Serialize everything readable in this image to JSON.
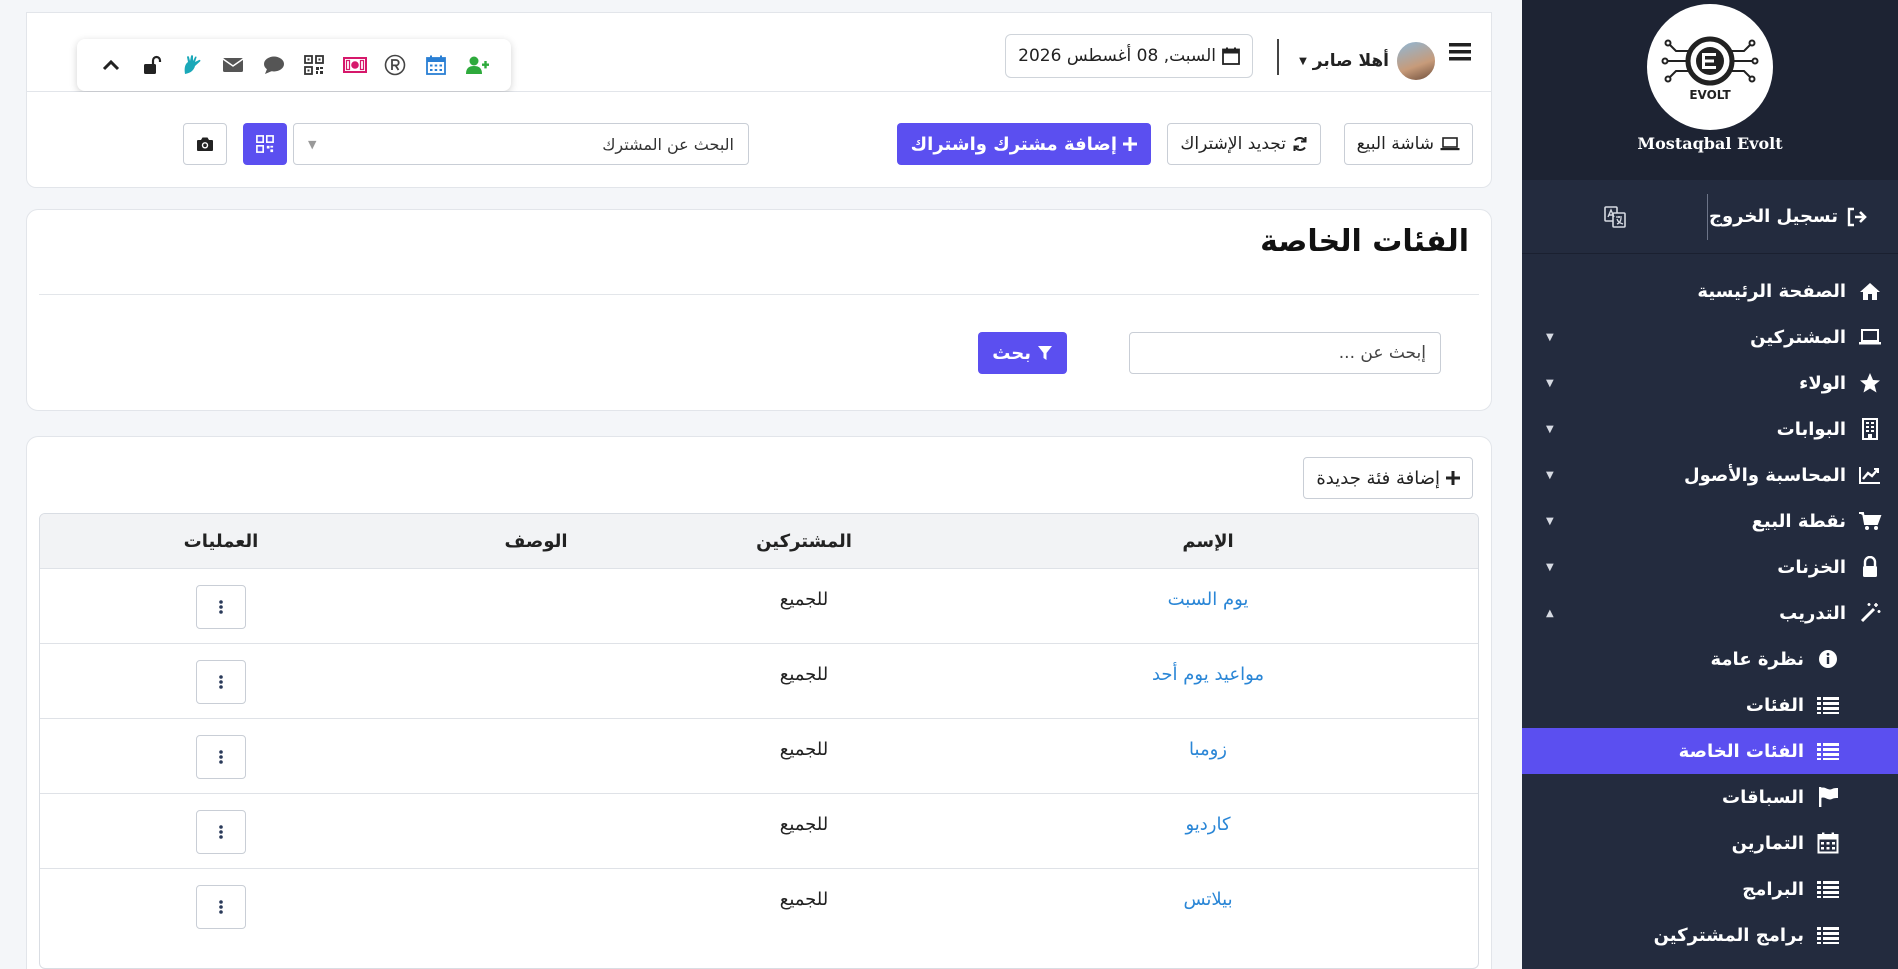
{
  "sidebar": {
    "brand": "Mostaqbal Evolt",
    "logo_text": "EVOLT",
    "logout_label": "تسجيل الخروج",
    "items": [
      {
        "label": "الصفحة الرئيسية",
        "icon": "home-icon",
        "caret": ""
      },
      {
        "label": "المشتركين",
        "icon": "laptop-icon",
        "caret": "▼"
      },
      {
        "label": "الولاء",
        "icon": "star-icon",
        "caret": "▼"
      },
      {
        "label": "البوابات",
        "icon": "building-icon",
        "caret": "▼"
      },
      {
        "label": "المحاسبة والأصول",
        "icon": "chart-line-icon",
        "caret": "▼"
      },
      {
        "label": "نقطة البيع",
        "icon": "cart-icon",
        "caret": "▼"
      },
      {
        "label": "الخزنات",
        "icon": "lock-icon",
        "caret": "▼"
      },
      {
        "label": "التدريب",
        "icon": "magic-wand-icon",
        "caret": "▲"
      }
    ],
    "subitems": [
      {
        "label": "نظرة عامة",
        "icon": "info-icon"
      },
      {
        "label": "الفئات",
        "icon": "list-icon"
      },
      {
        "label": "الفئات الخاصة",
        "icon": "list-icon",
        "active": true
      },
      {
        "label": "السباقات",
        "icon": "flag-icon"
      },
      {
        "label": "التمارين",
        "icon": "calendar-icon"
      },
      {
        "label": "البرامج",
        "icon": "list-icon"
      },
      {
        "label": "برامج المشتركين",
        "icon": "list-icon"
      }
    ]
  },
  "header": {
    "greeting": "أهلا صابر",
    "date": "السبت, 08 أغسطس 2026"
  },
  "actions": {
    "pos_label": "شاشة البيع",
    "renew_label": "تجديد الإشتراك",
    "add_sub_label": "إضافة مشترك واشتراك",
    "search_subscriber_placeholder": "البحث عن المشترك"
  },
  "filter": {
    "title": "الفئات الخاصة",
    "search_placeholder": "إبحث عن ...",
    "search_button": "بحث"
  },
  "table": {
    "add_button": "إضافة فئة جديدة",
    "headers": {
      "name": "الإسم",
      "subscribers": "المشتركين",
      "description": "الوصف",
      "operations": "العمليات"
    },
    "rows": [
      {
        "name": "يوم السبت",
        "subscribers": "للجميع",
        "description": ""
      },
      {
        "name": "مواعيد يوم أحد",
        "subscribers": "للجميع",
        "description": ""
      },
      {
        "name": "زومبا",
        "subscribers": "للجميع",
        "description": ""
      },
      {
        "name": "كارديو",
        "subscribers": "للجميع",
        "description": ""
      },
      {
        "name": "بيلاتس",
        "subscribers": "للجميع",
        "description": ""
      }
    ]
  },
  "colors": {
    "primary": "#5b4ff0",
    "sidebar": "#232b3e",
    "link": "#2a86d6"
  }
}
